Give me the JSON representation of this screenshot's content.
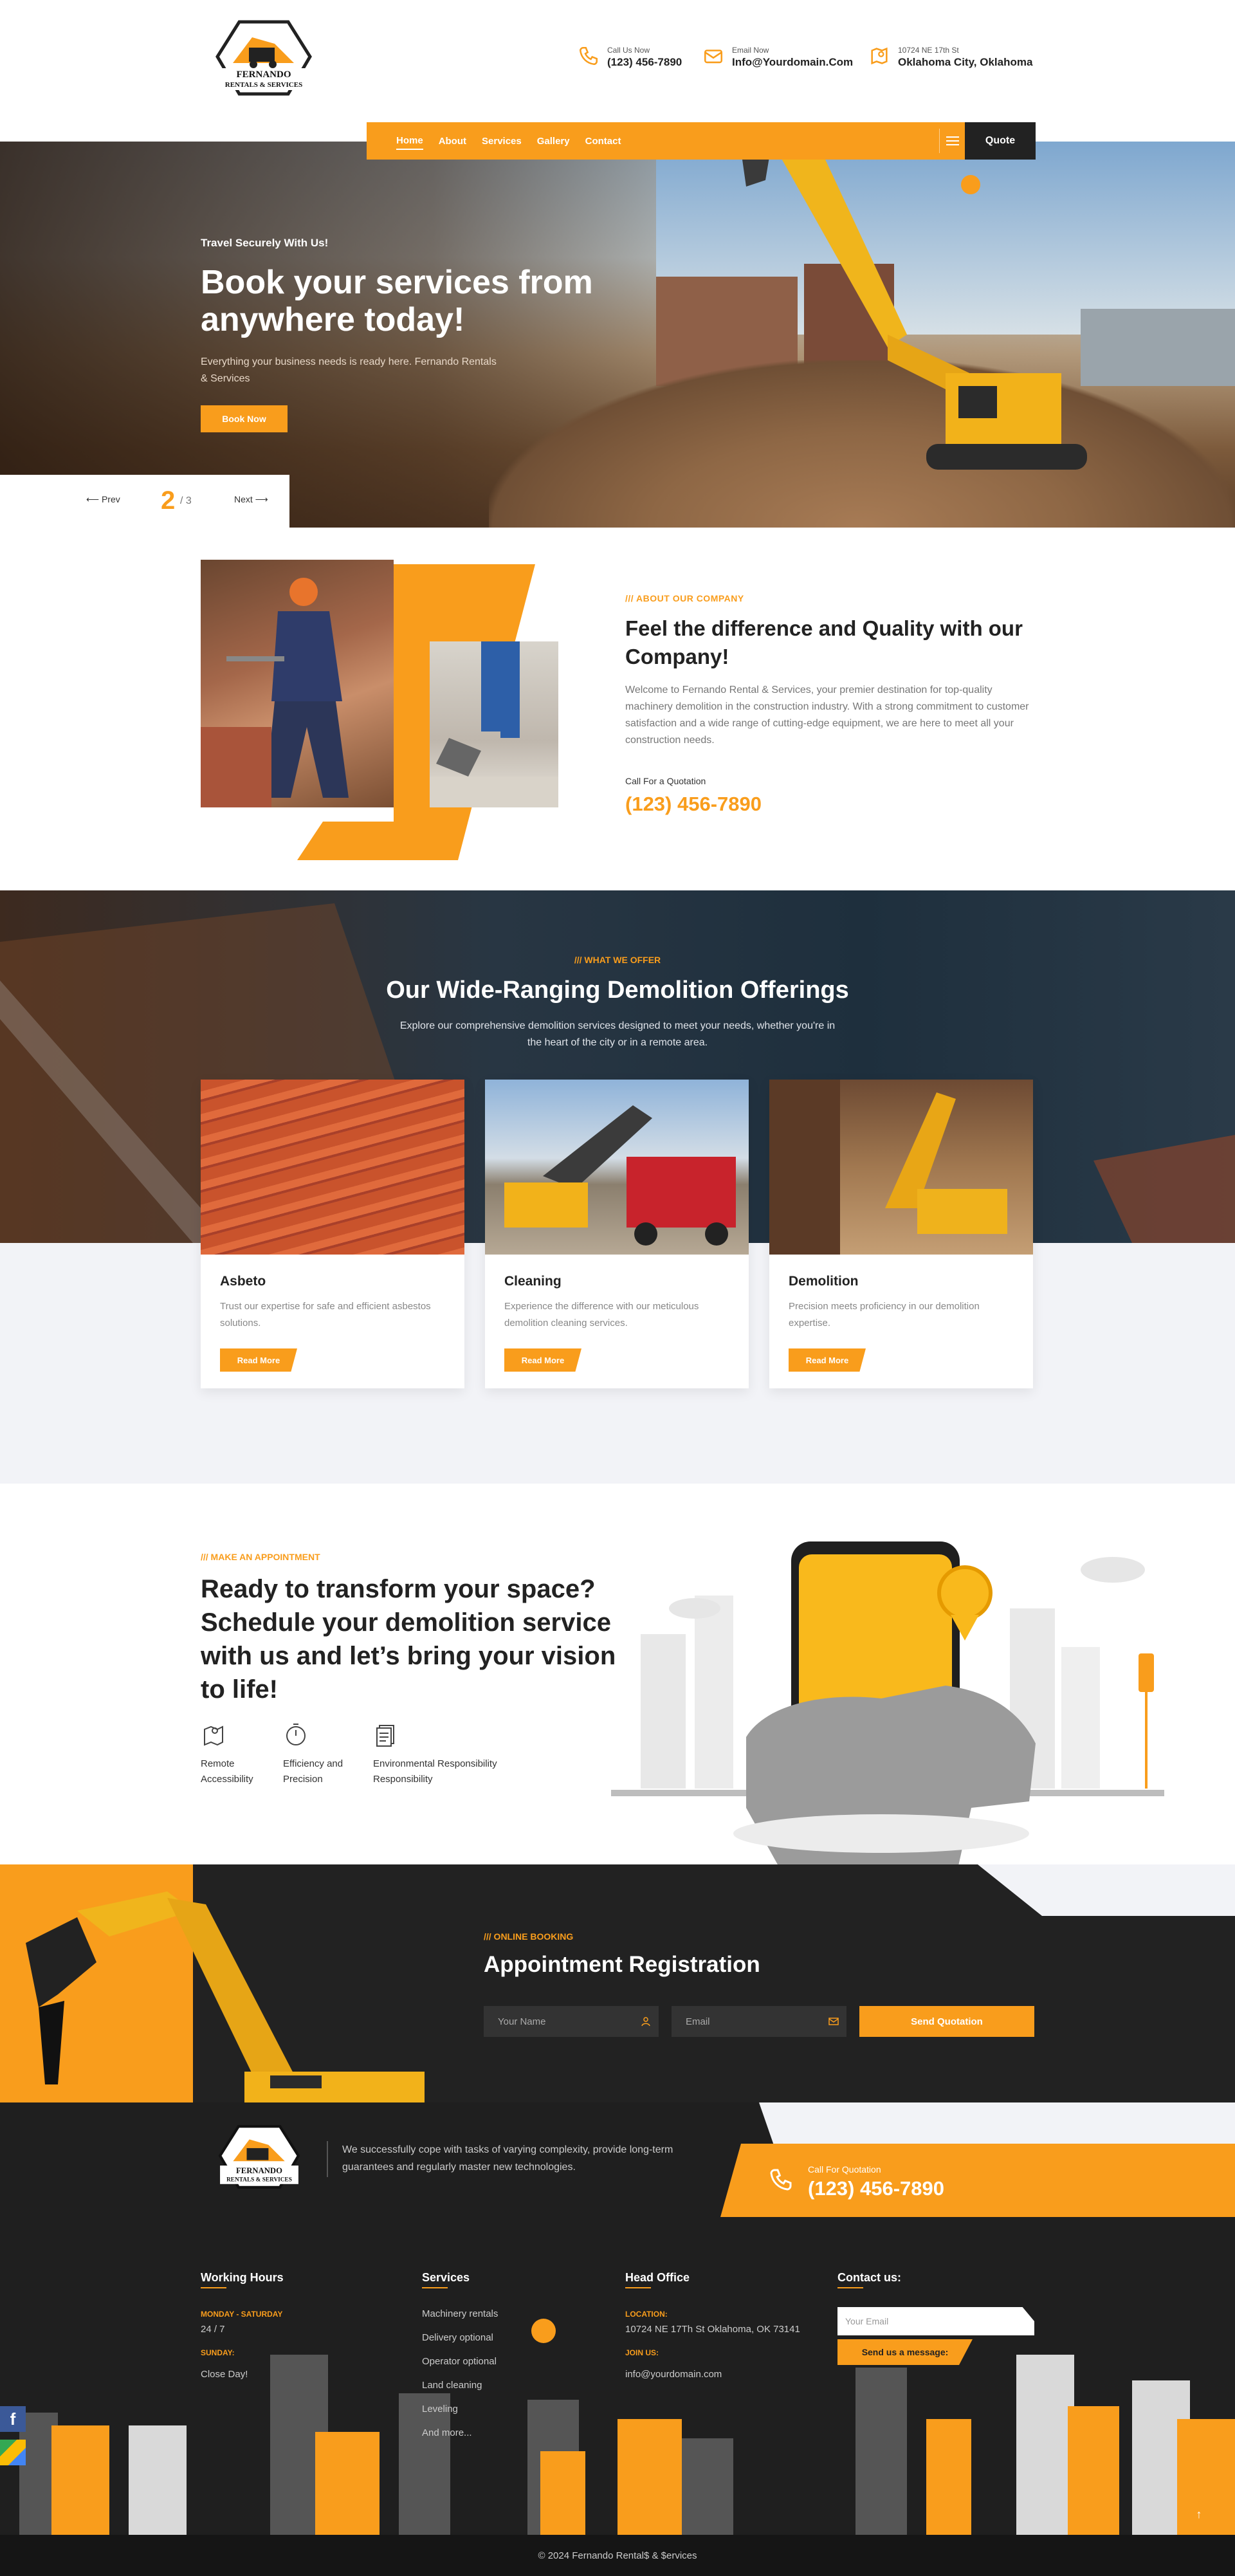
{
  "header": {
    "logo_text": "FERNANDO RENTALS & SERVICES",
    "call_label": "Call Us Now",
    "call_value": "(123) 456-7890",
    "email_label": "Email Now",
    "email_value": "Info@Yourdomain.Com",
    "address_label": "10724 NE 17th St",
    "address_value": "Oklahoma City, Oklahoma"
  },
  "nav": {
    "items": [
      "Home",
      "About",
      "Services",
      "Gallery",
      "Contact"
    ],
    "quote": "Quote"
  },
  "hero": {
    "tagline": "Travel Securely With Us!",
    "title": "Book your services from anywhere today!",
    "text": "Everything your business needs is ready here. Fernando Rentals & Services",
    "button": "Book Now",
    "prev": "Prev",
    "current": "2",
    "total": "/ 3",
    "next": "Next"
  },
  "about": {
    "tag": "/// ABOUT OUR COMPANY",
    "title": "Feel the difference and Quality with our Company!",
    "text": "Welcome to Fernando Rental & Services, your premier destination for top-quality machinery demolition in the construction industry. With a strong commitment to customer satisfaction and a wide range of cutting-edge equipment, we are here to meet all your construction needs.",
    "call_label": "Call For a Quotation",
    "phone": "(123) 456-7890"
  },
  "services": {
    "tag": "/// WHAT WE OFFER",
    "title": "Our Wide-Ranging Demolition Offerings",
    "text": "Explore our comprehensive demolition services designed to meet your needs, whether you're in the heart of the city or in a remote area.",
    "cards": [
      {
        "title": "Asbeto",
        "text": "Trust our expertise for safe and efficient asbestos solutions.",
        "button": "Read More"
      },
      {
        "title": "Cleaning",
        "text": "Experience the difference with our meticulous demolition cleaning services.",
        "button": "Read More"
      },
      {
        "title": "Demolition",
        "text": "Precision meets proficiency in our demolition expertise.",
        "button": "Read More"
      }
    ]
  },
  "appointment": {
    "tag": "/// MAKE AN APPOINTMENT",
    "title": "Ready to transform your space? Schedule your demolition service with us and let’s bring your vision to life!",
    "features": [
      {
        "line1": "Remote",
        "line2": "Accessibility",
        "icon": "map-icon"
      },
      {
        "line1": "Efficiency and",
        "line2": "Precision",
        "icon": "stopwatch-icon"
      },
      {
        "line1": "Environmental Responsibility",
        "line2": "Responsibility",
        "icon": "document-icon"
      }
    ]
  },
  "booking": {
    "tag": "/// ONLINE BOOKING",
    "title": "Appointment Registration",
    "name_placeholder": "Your Name",
    "email_placeholder": "Email",
    "button": "Send Quotation"
  },
  "footer": {
    "logo_text": "FERNANDO RENTALS & SERVICES",
    "about": "We successfully cope with tasks of varying complexity, provide long-term guarantees and regularly master new technologies.",
    "call_label": "Call For Quotation",
    "call_phone": "(123) 456-7890",
    "hours_title": "Working Hours",
    "hours_day1": "MONDAY - SATURDAY",
    "hours_val1": "24 / 7",
    "hours_day2": "SUNDAY:",
    "hours_val2": "Close Day!",
    "services_title": "Services",
    "services": [
      "Machinery rentals",
      "Delivery optional",
      "Operator optional",
      "Land cleaning",
      "Leveling",
      "And more..."
    ],
    "office_title": "Head Office",
    "loc_label": "LOCATION:",
    "loc_val": "10724 NE 17Th St Oklahoma, OK 73141",
    "join_label": "JOIN US:",
    "join_val": "info@yourdomain.com",
    "contact_title": "Contact us:",
    "contact_placeholder": "Your Email",
    "contact_button": "Send us a message:",
    "copyright": "© 2024 Fernando Rental$ & $ervices"
  },
  "colors": {
    "accent": "#F99D1C",
    "dark": "#222222",
    "light": "#f2f3f7"
  }
}
